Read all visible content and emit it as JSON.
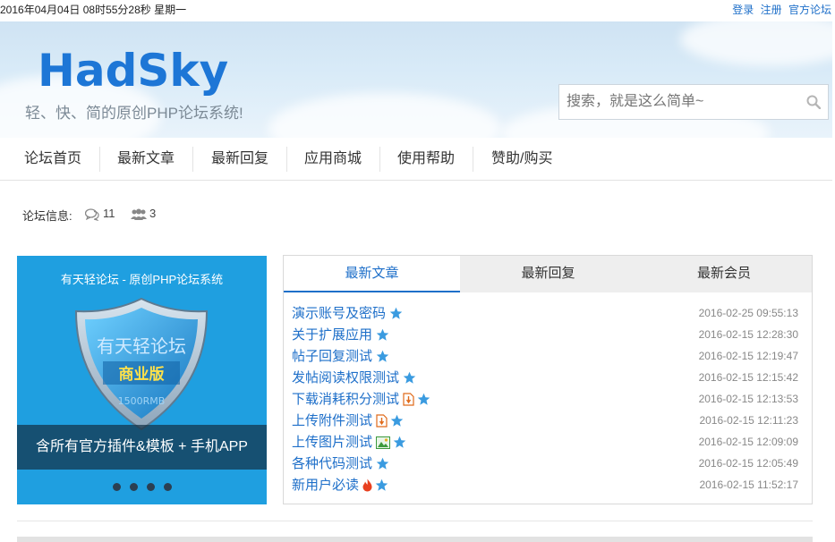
{
  "topbar": {
    "datetime": "2016年04月04日 08时55分28秒 星期一",
    "links": [
      "登录",
      "注册",
      "官方论坛"
    ]
  },
  "header": {
    "logo_text": "HadSky",
    "slogan": "轻、快、简的原创PHP论坛系统!",
    "search_placeholder": "搜索，就是这么简单~"
  },
  "nav": {
    "items": [
      "论坛首页",
      "最新文章",
      "最新回复",
      "应用商城",
      "使用帮助",
      "赞助/购买"
    ]
  },
  "forum_info": {
    "label": "论坛信息:",
    "posts": "11",
    "members": "3"
  },
  "banner": {
    "title": "有天轻论坛 - 原创PHP论坛系统",
    "shield_text": "有天轻论坛",
    "shield_badge": "商业版",
    "shield_price": "1500RMB",
    "caption": "含所有官方插件&模板 + 手机APP",
    "slides": 4
  },
  "tabs": [
    "最新文章",
    "最新回复",
    "最新会员"
  ],
  "posts": [
    {
      "title": "演示账号及密码",
      "date": "2016-02-25 09:55:13",
      "icons": [
        "star-icon"
      ]
    },
    {
      "title": "关于扩展应用",
      "date": "2016-02-15 12:28:30",
      "icons": [
        "star-icon"
      ]
    },
    {
      "title": "帖子回复测试",
      "date": "2016-02-15 12:19:47",
      "icons": [
        "star-icon"
      ]
    },
    {
      "title": "发帖阅读权限测试",
      "date": "2016-02-15 12:15:42",
      "icons": [
        "star-icon"
      ]
    },
    {
      "title": "下载消耗积分测试",
      "date": "2016-02-15 12:13:53",
      "icons": [
        "attachment-icon",
        "star-icon"
      ]
    },
    {
      "title": "上传附件测试",
      "date": "2016-02-15 12:11:23",
      "icons": [
        "attachment-icon",
        "star-icon"
      ]
    },
    {
      "title": "上传图片测试",
      "date": "2016-02-15 12:09:09",
      "icons": [
        "image-icon",
        "star-icon"
      ]
    },
    {
      "title": "各种代码测试",
      "date": "2016-02-15 12:05:49",
      "icons": [
        "star-icon"
      ]
    },
    {
      "title": "新用户必读",
      "date": "2016-02-15 11:52:17",
      "icons": [
        "hot-icon",
        "star-icon"
      ]
    }
  ],
  "colors": {
    "link": "#1e6fc9",
    "logo": "#1d76d6",
    "banner_bg": "#1f9fe0",
    "star": "#3a9be0"
  }
}
